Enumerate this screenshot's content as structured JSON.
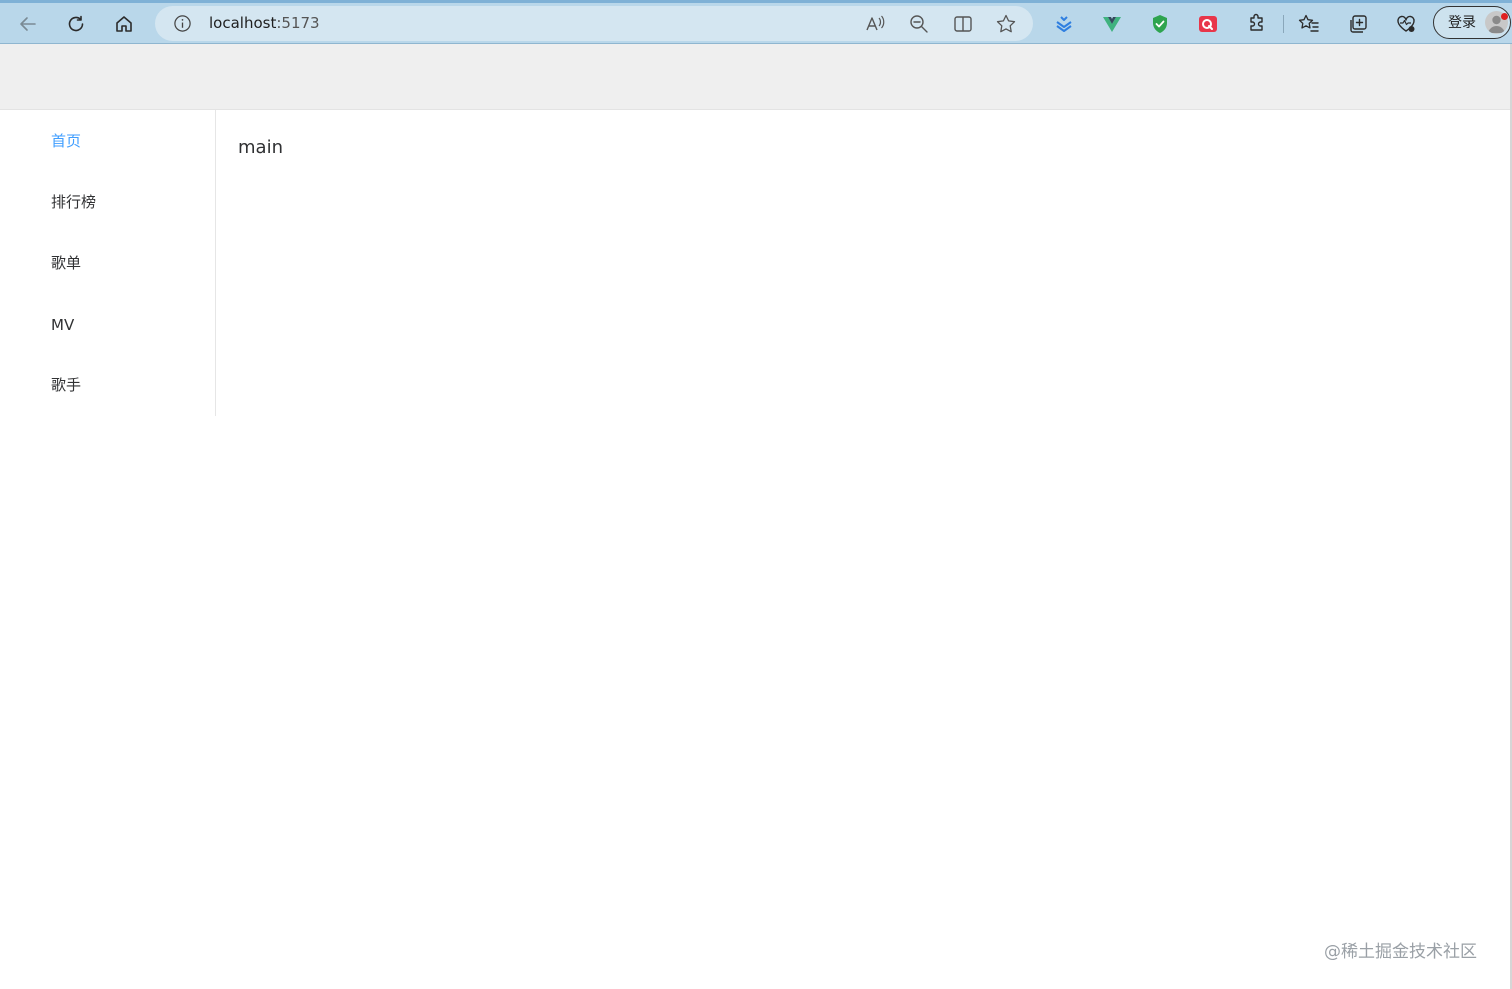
{
  "browser": {
    "address": {
      "host": "localhost",
      "port": ":5173"
    },
    "login_label": "登录"
  },
  "sidebar": {
    "items": [
      {
        "label": "首页",
        "active": true
      },
      {
        "label": "排行榜",
        "active": false
      },
      {
        "label": "歌单",
        "active": false
      },
      {
        "label": "MV",
        "active": false
      },
      {
        "label": "歌手",
        "active": false
      }
    ]
  },
  "main": {
    "text": "main"
  },
  "watermark": "@稀土掘金技术社区",
  "colors": {
    "active_menu": "#409eff",
    "header_bg": "#efefef",
    "chrome_bg": "#b9d7ea"
  },
  "icons": {
    "nav": [
      "back-arrow-icon",
      "refresh-icon",
      "home-icon"
    ],
    "address_tools": [
      "read-aloud-icon",
      "zoom-out-icon",
      "split-screen-icon",
      "favorite-star-icon"
    ],
    "extensions": [
      "layers-extension-icon",
      "vue-devtools-icon",
      "shield-check-icon",
      "red-extension-icon",
      "puzzle-extensions-icon",
      "favorites-list-icon",
      "collections-icon",
      "browser-essentials-icon"
    ]
  }
}
